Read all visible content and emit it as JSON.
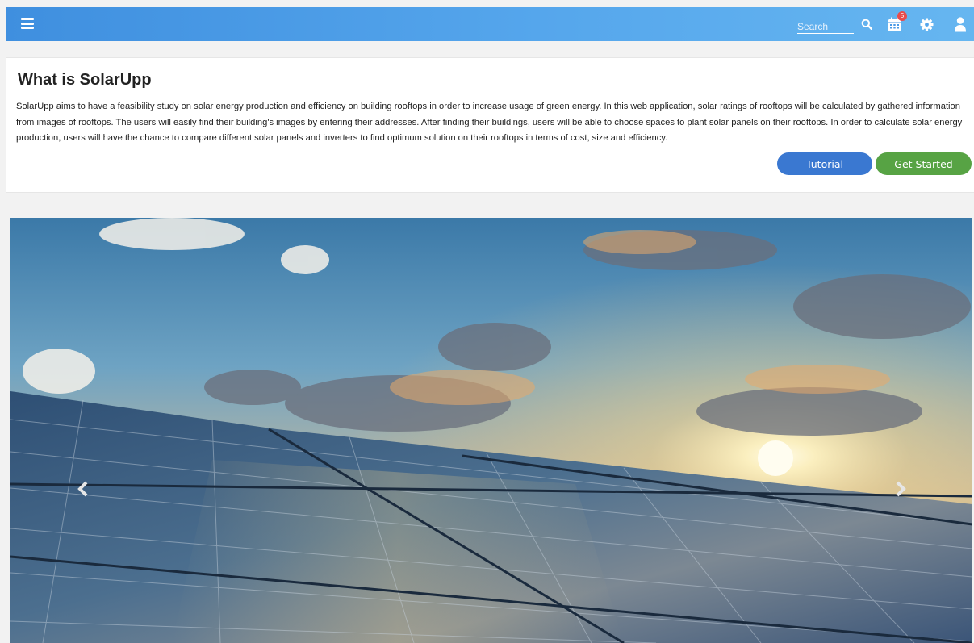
{
  "navbar": {
    "search_placeholder": "Search",
    "notification_count": "5",
    "colors": {
      "bar_start": "#3f8fdf",
      "bar_end": "#66b6f0",
      "badge": "#e94c4c"
    },
    "icons": [
      "menu-icon",
      "search-icon",
      "calendar-icon",
      "gear-icon",
      "user-icon"
    ]
  },
  "intro": {
    "title": "What is SolarUpp",
    "body": "SolarUpp aims to have a feasibility study on solar energy production and efficiency on building rooftops in order to increase usage of green energy. In this web application, solar ratings of rooftops will be calculated by gathered information from images of rooftops. The users will easily find their building's images by entering their addresses. After finding their buildings, users will be able to choose spaces to plant solar panels on their rooftops. In order to calculate solar energy production, users will have the chance to compare different solar panels and inverters to find optimum solution on their rooftops in terms of cost, size and efficiency.",
    "tutorial_label": "Tutorial",
    "get_started_label": "Get Started",
    "colors": {
      "tutorial": "#3a78d1",
      "get_started": "#57a344"
    }
  },
  "carousel": {
    "icons": [
      "chevron-left-icon",
      "chevron-right-icon"
    ]
  }
}
